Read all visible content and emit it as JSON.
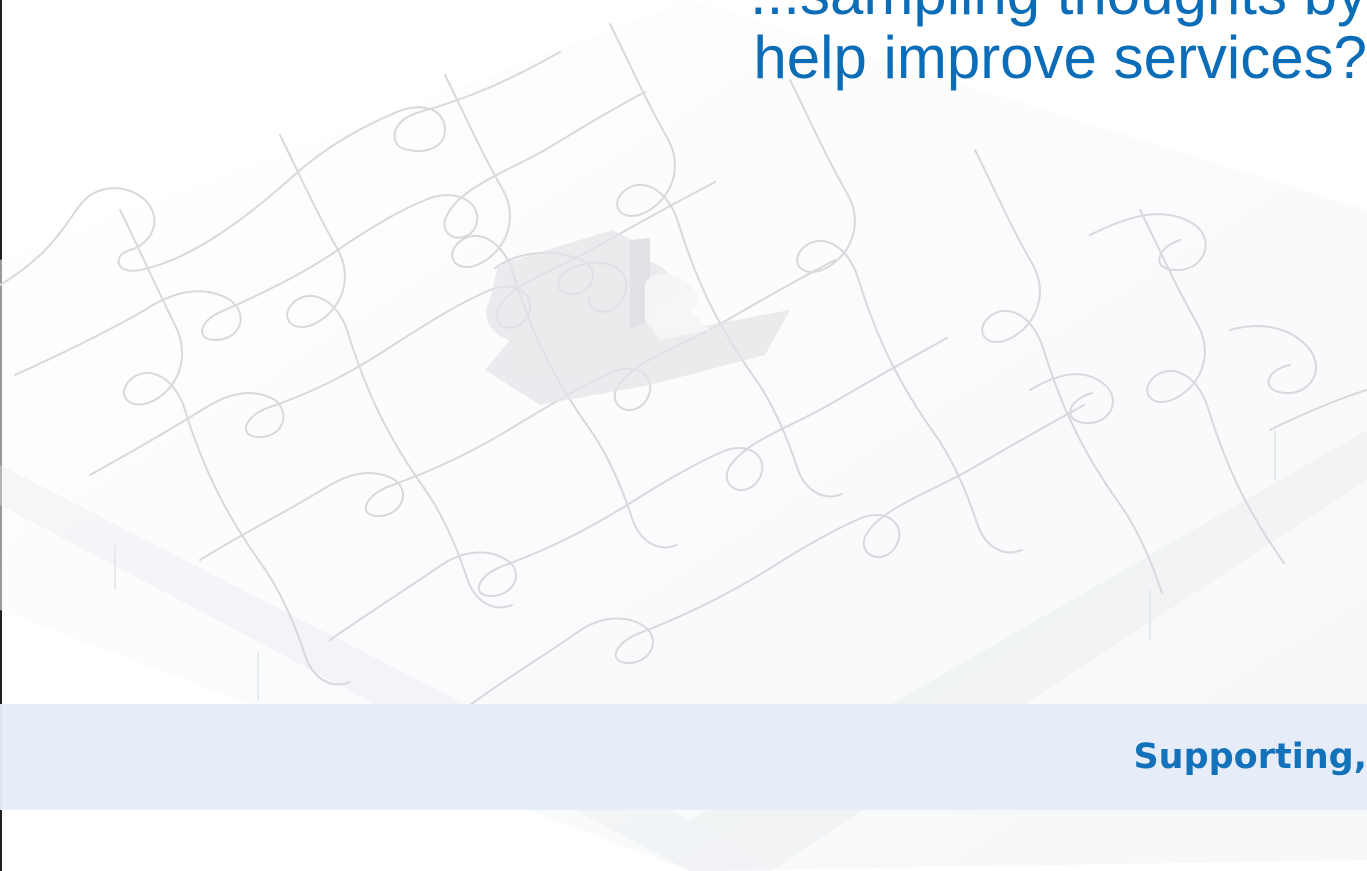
{
  "slide": {
    "title_lines": [
      "...sampling thoughts by",
      "help improve services?"
    ],
    "tagline": "Supporting,"
  },
  "colors": {
    "title": "#0b6db8",
    "tagline_band": "#e7edf8",
    "puzzle_outline": "#d7d9dc",
    "left_rule": "#1f1f1f"
  }
}
